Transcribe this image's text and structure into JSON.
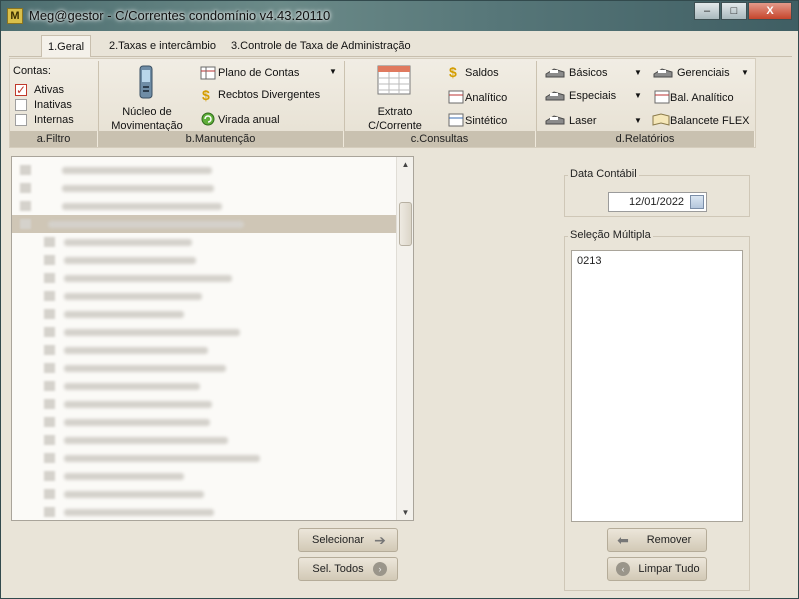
{
  "window": {
    "title": "Meg@gestor - C/Correntes condomínio v4.43.20110",
    "minimize": "–",
    "maximize": "□",
    "close": "X"
  },
  "tabs": [
    {
      "label": "1.Geral",
      "active": true
    },
    {
      "label": "2.Taxas e intercâmbio",
      "active": false
    },
    {
      "label": "3.Controle de Taxa de Administração",
      "active": false
    }
  ],
  "ribbon": {
    "filtro": {
      "title": "Contas:",
      "options": [
        {
          "label": "Ativas",
          "checked": true
        },
        {
          "label": "Inativas",
          "checked": false
        },
        {
          "label": "Internas",
          "checked": false
        }
      ],
      "group_label": "a.Filtro"
    },
    "manutencao": {
      "nucleo": "Núcleo de Movimentação",
      "plano": "Plano de Contas",
      "recbtos": "Recbtos Divergentes",
      "virada": "Virada anual",
      "group_label": "b.Manutenção"
    },
    "consultas": {
      "extrato": "Extrato C/Corrente",
      "saldos": "Saldos",
      "analitico": "Analítico",
      "sintetico": "Sintético",
      "group_label": "c.Consultas"
    },
    "relatorios": {
      "basicos": "Básicos",
      "especiais": "Especiais",
      "laser": "Laser",
      "gerenciais": "Gerenciais",
      "bal_analitico": "Bal. Analítico",
      "balancete": "Balancete FLEX",
      "group_label": "d.Relatórios"
    }
  },
  "tree": {
    "selected_index": 3
  },
  "buttons": {
    "selecionar": "Selecionar",
    "sel_todos": "Sel. Todos",
    "remover": "Remover",
    "limpar_tudo": "Limpar Tudo"
  },
  "data_contabil": {
    "label": "Data Contábil",
    "value": "12/01/2022"
  },
  "selecao": {
    "label": "Seleção Múltipla",
    "items": [
      "0213"
    ]
  }
}
